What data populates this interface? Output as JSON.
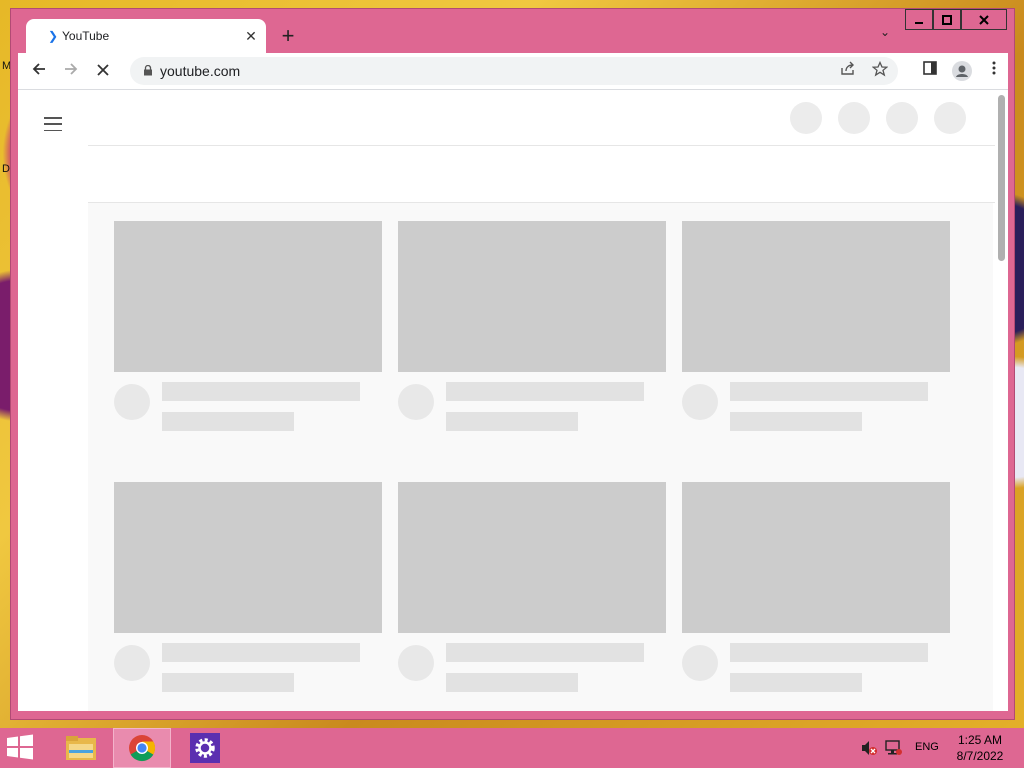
{
  "desktop": {
    "icon_labels": [
      "M",
      "D"
    ]
  },
  "browser": {
    "tab": {
      "title": "YouTube",
      "favicon": "loading-icon",
      "close_icon": "close-icon"
    },
    "new_tab_icon": "plus-icon",
    "tab_search_icon": "chevron-down-icon",
    "window_controls": {
      "minimize": "minimize-icon",
      "maximize": "maximize-icon",
      "close": "close-icon"
    },
    "toolbar": {
      "back_icon": "back-arrow-icon",
      "forward_icon": "forward-arrow-icon",
      "stop_icon": "stop-loading-icon",
      "url": "youtube.com",
      "lock_icon": "lock-icon",
      "share_icon": "share-icon",
      "bookmark_icon": "star-icon",
      "sidepanel_icon": "side-panel-icon",
      "profile_icon": "profile-icon",
      "menu_icon": "kebab-menu-icon"
    }
  },
  "youtube": {
    "menu_icon": "hamburger-icon",
    "header_placeholders": 4,
    "feed_cards": 6,
    "skeleton_color": "#cccccc"
  },
  "taskbar": {
    "start_icon": "windows-start-icon",
    "apps": [
      {
        "name": "file-explorer",
        "icon": "folder-icon"
      },
      {
        "name": "chrome",
        "icon": "chrome-icon",
        "active": true
      },
      {
        "name": "settings",
        "icon": "gear-icon"
      }
    ],
    "tray": {
      "volume_icon": "volume-muted-icon",
      "network_icon": "network-icon",
      "language": "ENG",
      "time": "1:25 AM",
      "date": "8/7/2022"
    }
  },
  "colors": {
    "window_frame": "#de6792",
    "accent_blue": "#1a73e8"
  }
}
